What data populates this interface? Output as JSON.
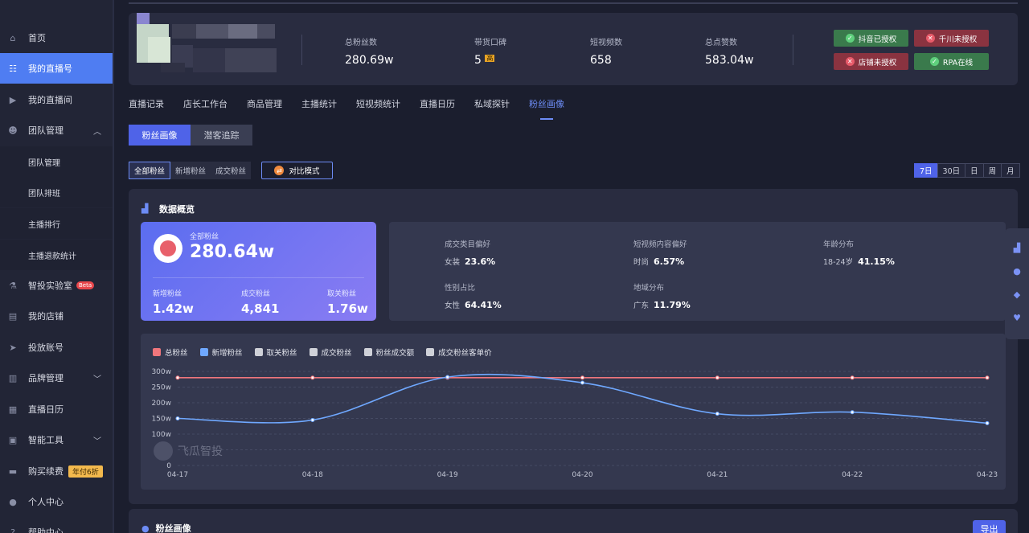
{
  "sidebar": {
    "items": [
      {
        "label": "首页",
        "icon": "home-icon"
      },
      {
        "label": "我的直播号",
        "icon": "list-icon"
      },
      {
        "label": "我的直播间",
        "icon": "play-icon"
      },
      {
        "label": "团队管理",
        "icon": "team-icon"
      },
      {
        "label": "团队管理",
        "icon": ""
      },
      {
        "label": "团队排班",
        "icon": ""
      },
      {
        "label": "主播排行",
        "icon": ""
      },
      {
        "label": "主播退款统计",
        "icon": ""
      },
      {
        "label": "智投实验室",
        "icon": "lab-icon"
      },
      {
        "label": "我的店铺",
        "icon": "shop-icon"
      },
      {
        "label": "投放账号",
        "icon": "send-icon"
      },
      {
        "label": "品牌管理",
        "icon": "chart-icon"
      },
      {
        "label": "直播日历",
        "icon": "calendar-icon"
      },
      {
        "label": "智能工具",
        "icon": "toolbox-icon"
      },
      {
        "label": "购买续费",
        "icon": "card-icon"
      },
      {
        "label": "个人中心",
        "icon": "user-icon"
      },
      {
        "label": "帮助中心",
        "icon": "help-icon"
      }
    ],
    "beta": "Beta",
    "year_badge": "年付6折"
  },
  "stats": {
    "total_fans_label": "总粉丝数",
    "total_fans": "280.69w",
    "brand_label": "带货口碑",
    "brand": "5",
    "brand_tag": "高",
    "videos_label": "短视频数",
    "videos": "658",
    "likes_label": "总点赞数",
    "likes": "583.04w"
  },
  "auth": {
    "douyin": "抖音已授权",
    "qianchuan": "千川未授权",
    "shop": "店铺未授权",
    "rpa": "RPA在线"
  },
  "tabs": [
    "直播记录",
    "店长工作台",
    "商品管理",
    "主播统计",
    "短视频统计",
    "直播日历",
    "私域探针",
    "粉丝画像"
  ],
  "subtabs": [
    "粉丝画像",
    "潜客追踪"
  ],
  "filters": [
    "全部粉丝",
    "新增粉丝",
    "成交粉丝"
  ],
  "compare_label": "对比模式",
  "periods": [
    "7日",
    "30日",
    "日",
    "周",
    "月"
  ],
  "overview": {
    "title": "数据概览",
    "all_fans_label": "全部粉丝",
    "all_fans": "280.64w",
    "new_label": "新增粉丝",
    "new": "1.42w",
    "deal_label": "成交粉丝",
    "deal": "4,841",
    "unfollow_label": "取关粉丝",
    "unfollow": "1.76w"
  },
  "prefs": {
    "cat_label": "成交类目偏好",
    "cat_name": "女装",
    "cat_val": "23.6%",
    "video_label": "短视频内容偏好",
    "video_name": "时尚",
    "video_val": "6.57%",
    "age_label": "年龄分布",
    "age_name": "18-24岁",
    "age_val": "41.15%",
    "gender_label": "性别占比",
    "gender_name": "女性",
    "gender_val": "64.41%",
    "region_label": "地域分布",
    "region_name": "广东",
    "region_val": "11.79%"
  },
  "legend": [
    {
      "name": "总粉丝",
      "color": "#f0767c"
    },
    {
      "name": "新增粉丝",
      "color": "#6fa8ff"
    },
    {
      "name": "取关粉丝",
      "color": "#cfd1d8"
    },
    {
      "name": "成交粉丝",
      "color": "#cfd1d8"
    },
    {
      "name": "粉丝成交额",
      "color": "#cfd1d8"
    },
    {
      "name": "成交粉丝客单价",
      "color": "#cfd1d8"
    }
  ],
  "watermark": "飞瓜智投",
  "chart_data": {
    "type": "line",
    "x": [
      "04-17",
      "04-18",
      "04-19",
      "04-20",
      "04-21",
      "04-22",
      "04-23"
    ],
    "y_ticks": [
      "300w",
      "250w",
      "200w",
      "150w",
      "100w",
      "50w",
      "0"
    ],
    "ylim": [
      0,
      300
    ],
    "series": [
      {
        "name": "总粉丝",
        "color": "#f0767c",
        "values": [
          280,
          280,
          280,
          280,
          280,
          280,
          280
        ]
      },
      {
        "name": "新增粉丝",
        "color": "#6fa8ff",
        "values": [
          150,
          145,
          282,
          264,
          165,
          170,
          135
        ]
      }
    ]
  },
  "bottom": {
    "title": "粉丝画像",
    "export": "导出"
  }
}
